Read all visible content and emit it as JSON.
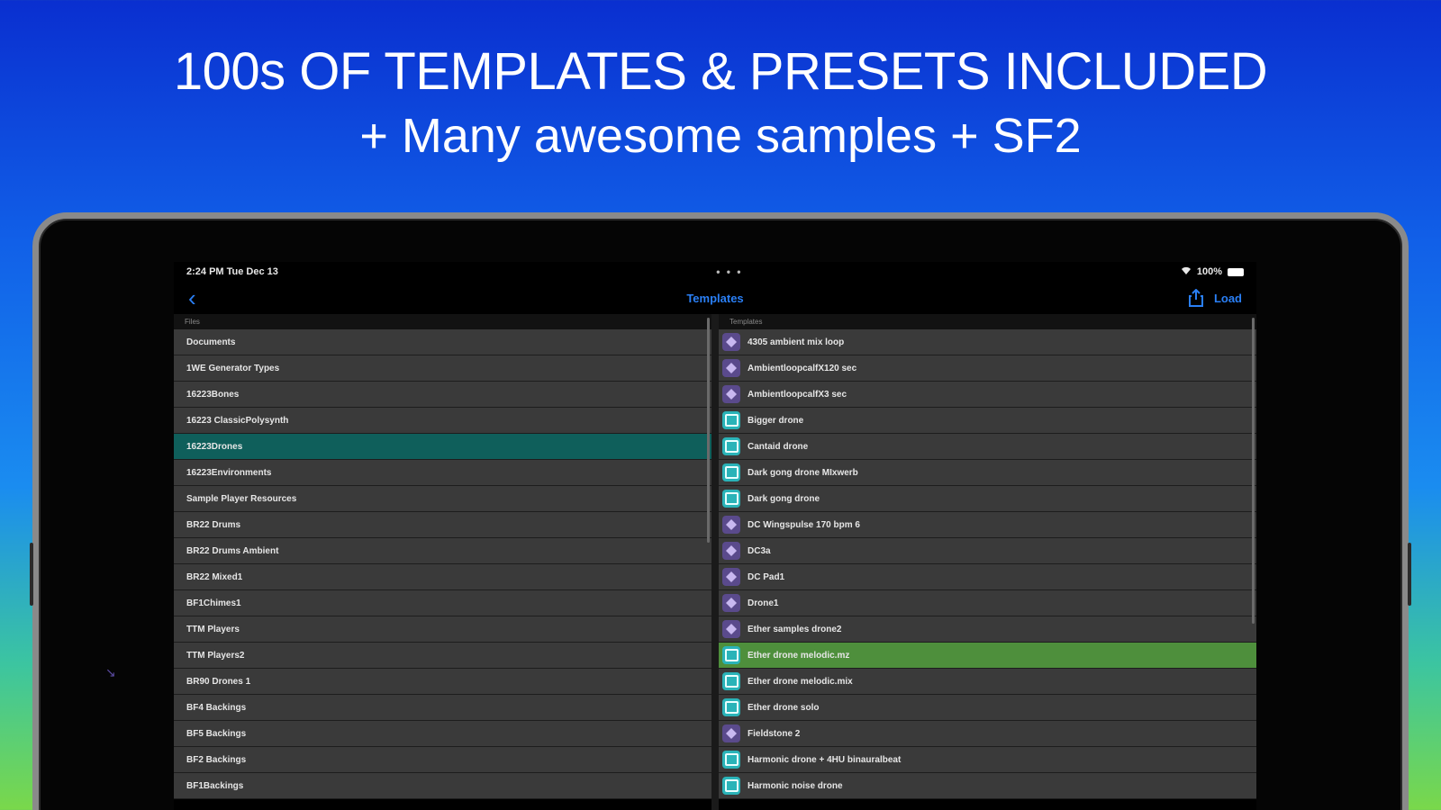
{
  "headline": {
    "line1": "100s OF TEMPLATES & PRESETS INCLUDED",
    "line2": "+ Many awesome samples + SF2"
  },
  "statusbar": {
    "time": "2:24 PM  Tue Dec 13",
    "dots": "• • •",
    "battery": "100%"
  },
  "navbar": {
    "back_icon": "chevron-left-icon",
    "title": "Templates",
    "share_icon": "share-icon",
    "load_label": "Load"
  },
  "files": {
    "header": "Files",
    "items": [
      "Documents",
      "1WE Generator Types",
      "16223Bones",
      "16223 ClassicPolysynth",
      "16223Drones",
      "16223Environments",
      "Sample Player Resources",
      "BR22 Drums",
      "BR22 Drums Ambient",
      "BR22 Mixed1",
      "BF1Chimes1",
      "TTM Players",
      "TTM Players2",
      "BR90 Drones 1",
      "BF4 Backings",
      "BF5 Backings",
      "BF2 Backings",
      "BF1Backings"
    ],
    "selected_index": 4
  },
  "templates": {
    "header": "Templates",
    "items": [
      {
        "label": "4305 ambient mix loop",
        "icon": "wave"
      },
      {
        "label": "AmbientloopcalfX120 sec",
        "icon": "wave"
      },
      {
        "label": "AmbientloopcalfX3 sec",
        "icon": "wave"
      },
      {
        "label": "Bigger drone",
        "icon": "drone"
      },
      {
        "label": "Cantaid drone",
        "icon": "drone"
      },
      {
        "label": "Dark gong drone MIxwerb",
        "icon": "drone"
      },
      {
        "label": "Dark gong drone",
        "icon": "drone"
      },
      {
        "label": "DC Wingspulse 170 bpm 6",
        "icon": "wave"
      },
      {
        "label": "DC3a",
        "icon": "wave"
      },
      {
        "label": "DC Pad1",
        "icon": "wave"
      },
      {
        "label": "Drone1",
        "icon": "wave"
      },
      {
        "label": "Ether samples drone2",
        "icon": "wave"
      },
      {
        "label": "Ether drone melodic.mz",
        "icon": "drone"
      },
      {
        "label": "Ether drone melodic.mix",
        "icon": "drone"
      },
      {
        "label": "Ether drone solo",
        "icon": "drone"
      },
      {
        "label": "Fieldstone 2",
        "icon": "wave"
      },
      {
        "label": "Harmonic drone + 4HU binauralbeat",
        "icon": "drone"
      },
      {
        "label": "Harmonic noise drone",
        "icon": "drone"
      }
    ],
    "selected_index": 12
  },
  "colors": {
    "teal_selection": "#0f5f5b",
    "green_selection": "#4e8f3c",
    "accent": "#2a7ff5"
  }
}
